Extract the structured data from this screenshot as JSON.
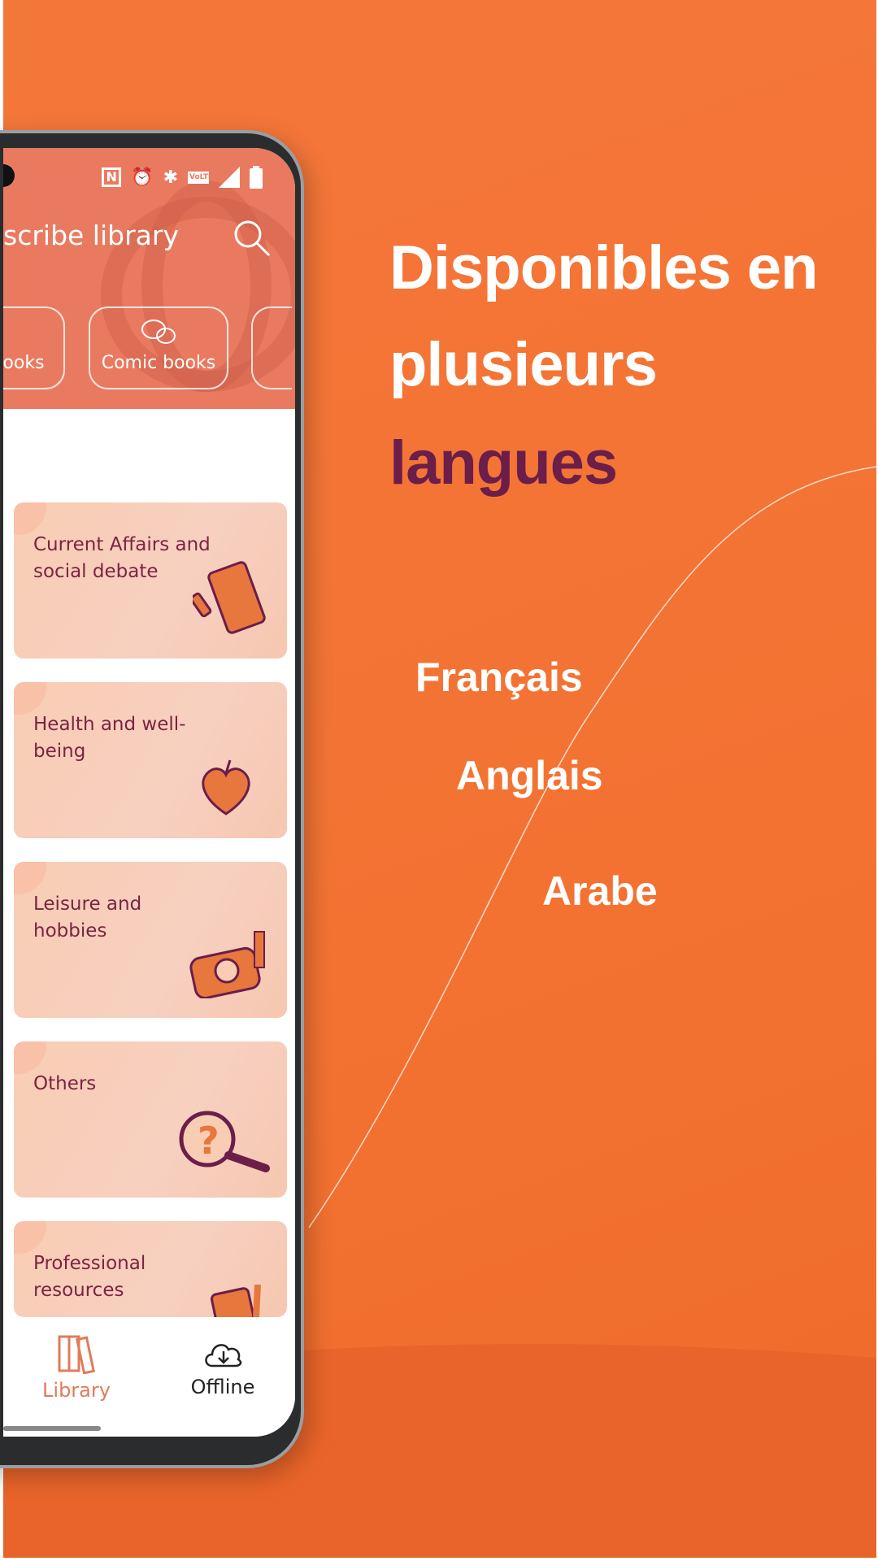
{
  "headline": {
    "line1": "Disponibles en",
    "line2": "plusieurs",
    "line3": "langues",
    "accent_color": "#6b1e4a"
  },
  "languages": [
    "Français",
    "Anglais",
    "Arabe"
  ],
  "colors": {
    "background": "#f37232",
    "app_header": "#e97a5f",
    "card_text": "#7c2342",
    "nav_active": "#e07b5a"
  },
  "app": {
    "status_icons": [
      "nfc-icon",
      "alarm-icon",
      "bluetooth-icon",
      "volte-icon",
      "signal-icon",
      "battery-icon"
    ],
    "status_volte": "VoLTE",
    "title": "scribe library",
    "chips": [
      {
        "label": "books",
        "icon": "book-icon"
      },
      {
        "label": "Comic books",
        "icon": "chat-bubbles-icon"
      },
      {
        "label": ""
      }
    ],
    "categories": [
      {
        "label": "Current Affairs and social debate",
        "icon": "phone-debate-icon"
      },
      {
        "label": "Health and well-being",
        "icon": "apple-heart-icon"
      },
      {
        "label": "Leisure and hobbies",
        "icon": "camera-icon"
      },
      {
        "label": "Others",
        "icon": "question-magnifier-icon"
      },
      {
        "label": "Professional resources",
        "icon": "tools-calculator-icon"
      }
    ],
    "nav": [
      {
        "label": "Library",
        "icon": "books-icon",
        "active": true
      },
      {
        "label": "Offline",
        "icon": "cloud-download-icon",
        "active": false
      }
    ]
  }
}
